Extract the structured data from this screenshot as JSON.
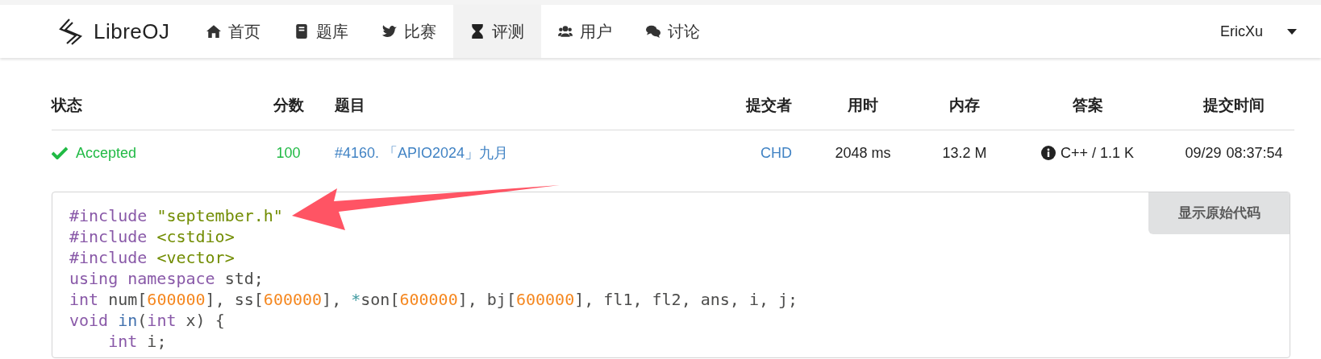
{
  "navbar": {
    "brand": "LibreOJ",
    "items": [
      {
        "label": "首页",
        "selected": false
      },
      {
        "label": "题库",
        "selected": false
      },
      {
        "label": "比赛",
        "selected": false
      },
      {
        "label": "评测",
        "selected": true
      },
      {
        "label": "用户",
        "selected": false
      },
      {
        "label": "讨论",
        "selected": false
      }
    ],
    "user": "EricXu"
  },
  "table": {
    "columns": [
      "状态",
      "分数",
      "题目",
      "提交者",
      "用时",
      "内存",
      "答案",
      "提交时间"
    ],
    "rows": [
      {
        "status": "Accepted",
        "score": "100",
        "problem": "#4160. 「APIO2024」九月",
        "submitter": "CHD",
        "time": "2048 ms",
        "memory": "13.2 M",
        "answer": "C++ / 1.1 K",
        "date": "09/29",
        "clock": "08:37:54"
      }
    ]
  },
  "code": {
    "button": "显示原始代码",
    "lines": [
      [
        {
          "kind": "meta",
          "text": "#include "
        },
        {
          "kind": "string",
          "text": "\"september.h\""
        }
      ],
      [
        {
          "kind": "meta",
          "text": "#include "
        },
        {
          "kind": "string",
          "text": "<cstdio>"
        }
      ],
      [
        {
          "kind": "meta",
          "text": "#include "
        },
        {
          "kind": "string",
          "text": "<vector>"
        }
      ],
      [
        {
          "kind": "keyword",
          "text": "using namespace"
        },
        {
          "kind": "plain",
          "text": " std;"
        }
      ],
      [
        {
          "kind": "keyword",
          "text": "int"
        },
        {
          "kind": "plain",
          "text": " num["
        },
        {
          "kind": "number",
          "text": "600000"
        },
        {
          "kind": "plain",
          "text": "], ss["
        },
        {
          "kind": "number",
          "text": "600000"
        },
        {
          "kind": "plain",
          "text": "], "
        },
        {
          "kind": "operator",
          "text": "*"
        },
        {
          "kind": "plain",
          "text": "son["
        },
        {
          "kind": "number",
          "text": "600000"
        },
        {
          "kind": "plain",
          "text": "], bj["
        },
        {
          "kind": "number",
          "text": "600000"
        },
        {
          "kind": "plain",
          "text": "], fl1, fl2, ans, i, j;"
        }
      ],
      [
        {
          "kind": "keyword",
          "text": "void "
        },
        {
          "kind": "function",
          "text": "in"
        },
        {
          "kind": "plain",
          "text": "("
        },
        {
          "kind": "keyword",
          "text": "int"
        },
        {
          "kind": "plain",
          "text": " x) {"
        }
      ],
      [
        {
          "kind": "keyword",
          "text": "    int"
        },
        {
          "kind": "plain",
          "text": " i;"
        }
      ]
    ]
  }
}
